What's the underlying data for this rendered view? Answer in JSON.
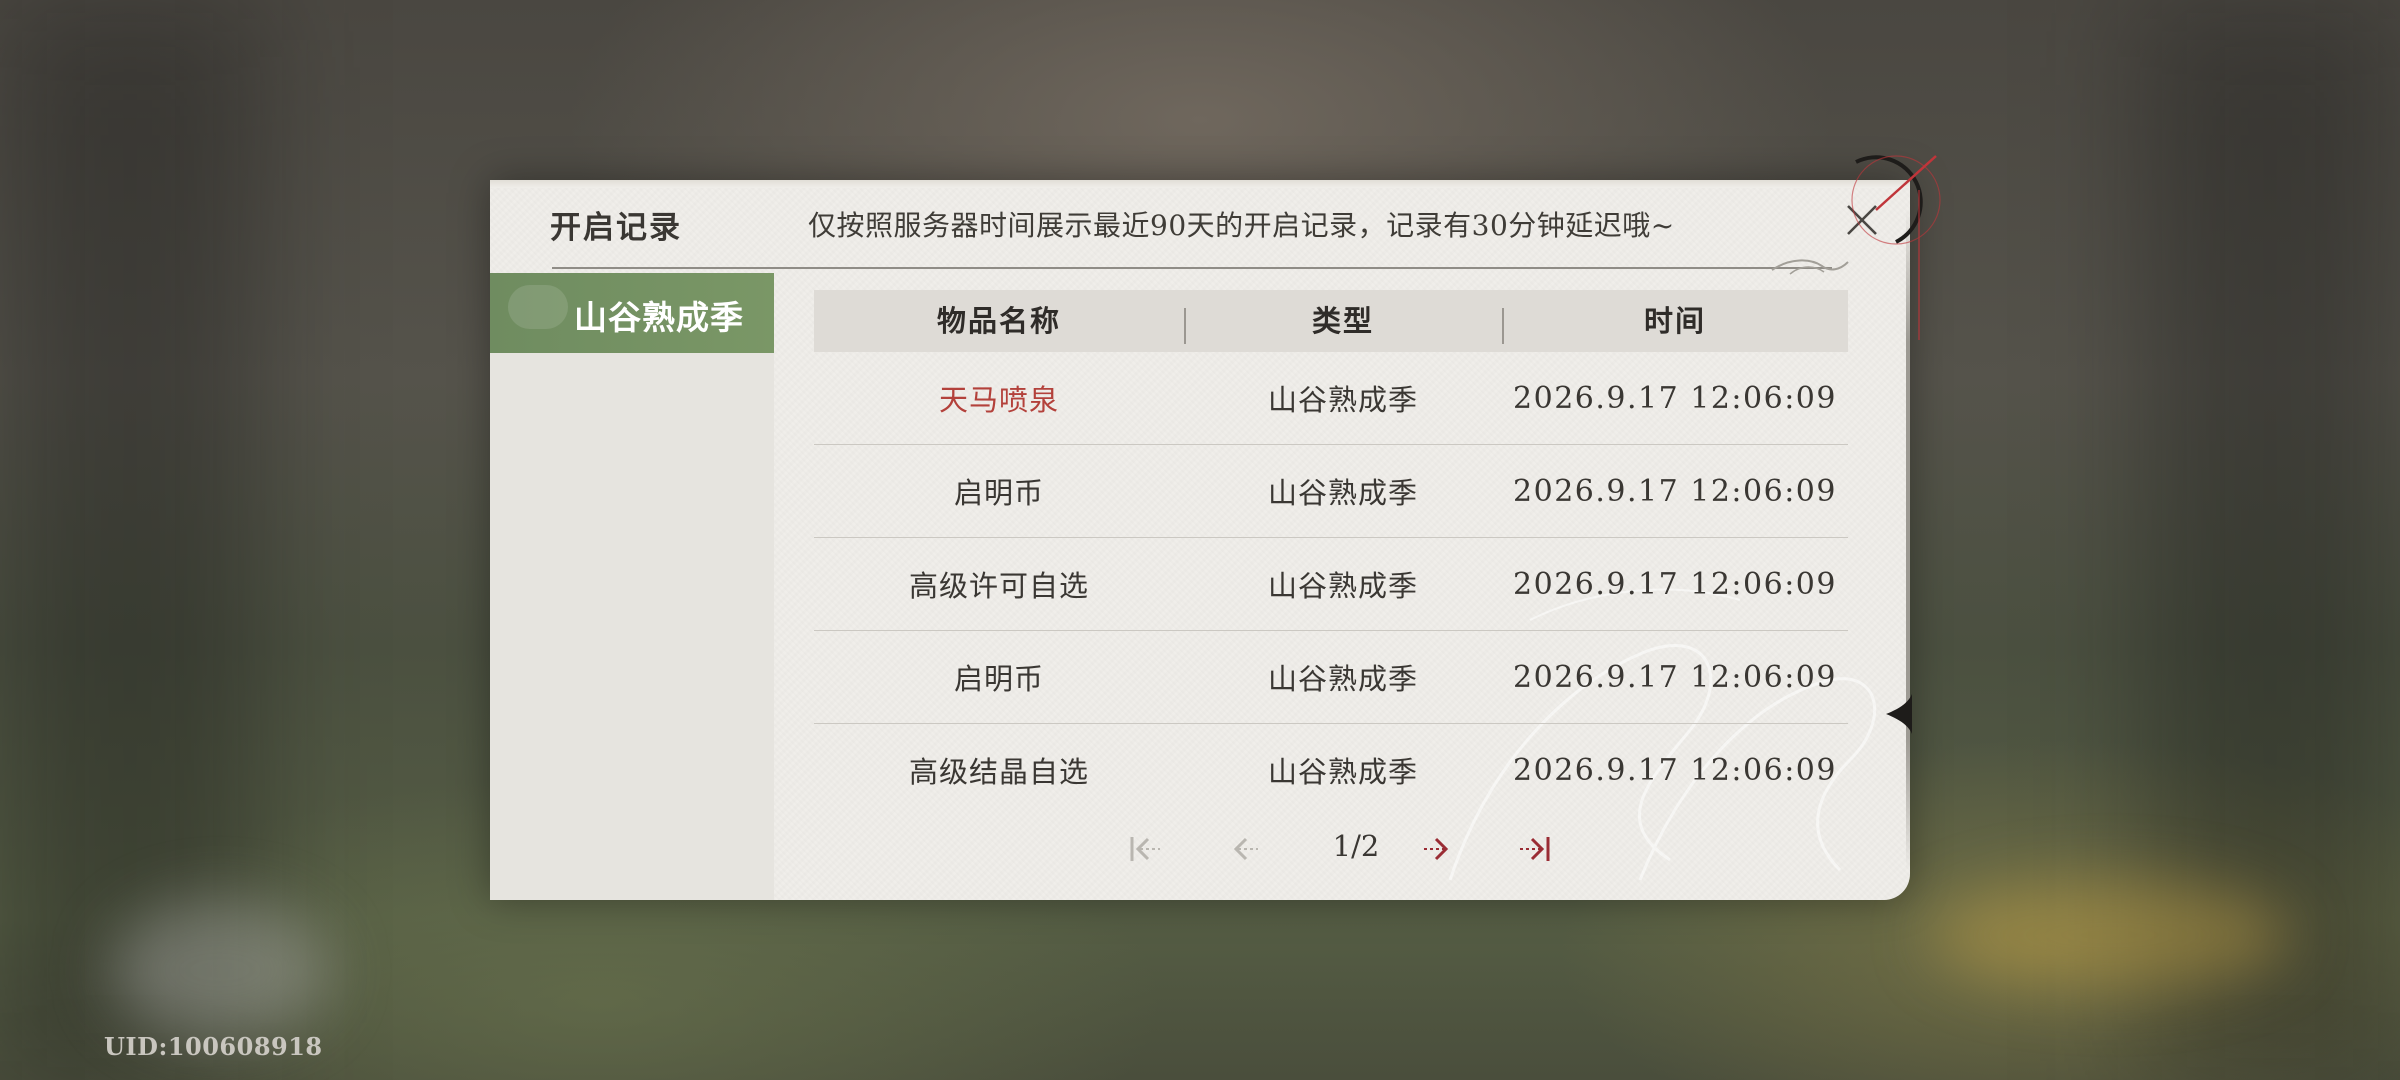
{
  "uid": "UID:100608918",
  "panel": {
    "title": "开启记录",
    "notice": "仅按照服务器时间展示最近90天的开启记录，记录有30分钟延迟哦~"
  },
  "sidebar": {
    "tabs": [
      {
        "label": "山谷熟成季",
        "active": true
      }
    ]
  },
  "table": {
    "headers": [
      "物品名称",
      "类型",
      "时间"
    ],
    "rows": [
      {
        "name": "天马喷泉",
        "type": "山谷熟成季",
        "time": "2026.9.17 12:06:09",
        "highlight": true
      },
      {
        "name": "启明币",
        "type": "山谷熟成季",
        "time": "2026.9.17 12:06:09",
        "highlight": false
      },
      {
        "name": "高级许可自选",
        "type": "山谷熟成季",
        "time": "2026.9.17 12:06:09",
        "highlight": false
      },
      {
        "name": "启明币",
        "type": "山谷熟成季",
        "time": "2026.9.17 12:06:09",
        "highlight": false
      },
      {
        "name": "高级结晶自选",
        "type": "山谷熟成季",
        "time": "2026.9.17 12:06:09",
        "highlight": false
      }
    ]
  },
  "pagination": {
    "text": "1/2",
    "first_disabled": true,
    "prev_disabled": true,
    "next_disabled": false,
    "last_disabled": false
  },
  "colors": {
    "accent_green": "#6f8c60",
    "highlight_red": "#b3413b",
    "active_arrow": "#9a2c34",
    "disabled_arrow": "#b9b6b0"
  },
  "icons": {
    "close": "close-icon",
    "first": "first-page-icon",
    "prev": "prev-page-icon",
    "next": "next-page-icon",
    "last": "last-page-icon"
  }
}
